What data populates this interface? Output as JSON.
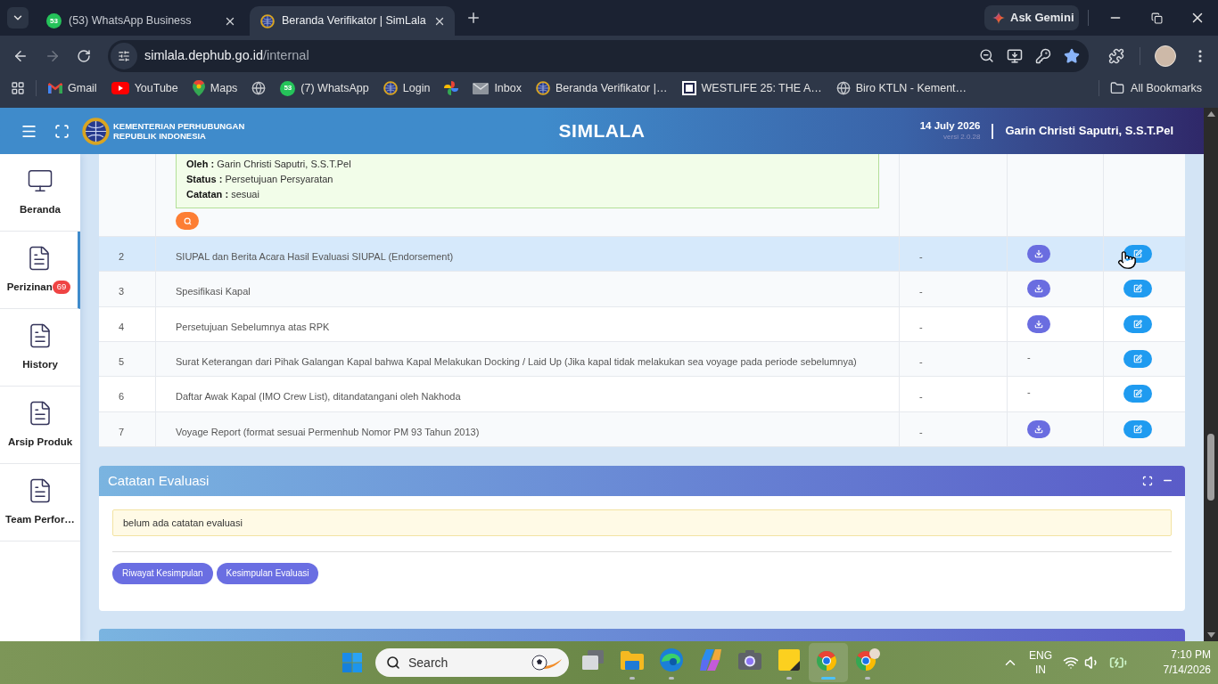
{
  "browser": {
    "tabs": [
      {
        "kind": "whatsapp",
        "favicon_text": "53",
        "title": "(53) WhatsApp Business",
        "selected": false
      },
      {
        "kind": "emblem",
        "title": "Beranda Verifikator | SimLala",
        "selected": true
      }
    ],
    "ask_gemini": "Ask Gemini",
    "url_host": "simlala.dephub.go.id",
    "url_path": "/internal",
    "bookmarks": [
      {
        "kind": "gmail",
        "label": "Gmail"
      },
      {
        "kind": "youtube",
        "label": "YouTube"
      },
      {
        "kind": "maps",
        "label": "Maps"
      },
      {
        "kind": "globe"
      },
      {
        "kind": "whatsapp",
        "icon_text": "53",
        "label": "(7) WhatsApp"
      },
      {
        "kind": "emblem",
        "label": "Login"
      },
      {
        "kind": "photos"
      },
      {
        "kind": "mail",
        "label": "Inbox"
      },
      {
        "kind": "emblem",
        "label": "Beranda Verifikator |…"
      },
      {
        "kind": "logo",
        "label": "WESTLIFE 25: THE A…"
      },
      {
        "kind": "globe",
        "label": "Biro KTLN - Kement…"
      }
    ],
    "all_bookmarks": "All Bookmarks"
  },
  "header": {
    "org_lines": [
      "KEMENTERIAN PERHUBUNGAN",
      "REPUBLIK INDONESIA"
    ],
    "title": "SIMLALA",
    "date": "14 July 2026",
    "version": "versi 2.0.28",
    "user": "Garin Christi Saputri, S.S.T.Pel"
  },
  "sidebar": {
    "items": [
      {
        "kind": "monitor",
        "label": "Beranda",
        "selected": false
      },
      {
        "kind": "document",
        "label": "Perizinan",
        "badge": "69",
        "selected": true
      },
      {
        "kind": "document",
        "label": "History",
        "selected": false
      },
      {
        "kind": "document",
        "label": "Arsip Produk",
        "selected": false
      },
      {
        "kind": "document",
        "label": "Team Perfor…",
        "selected": false
      }
    ]
  },
  "documents": {
    "open_row": {
      "entries": [
        {
          "label": "Oleh :",
          "value": "Garin Christi Saputri, S.S.T.Pel"
        },
        {
          "label": "Status :",
          "value": "Persetujuan Persyaratan"
        },
        {
          "label": "Catatan :",
          "value": "sesuai"
        }
      ]
    },
    "rows": [
      {
        "no": "2",
        "name": "SIUPAL dan Berita Acara Hasil Evaluasi SIUPAL (Endorsement)",
        "column_3": "-",
        "column_4": {
          "kind": "download"
        },
        "column_5": {
          "kind": "edit"
        },
        "hovered": true
      },
      {
        "no": "3",
        "name": "Spesifikasi Kapal",
        "column_3": "-",
        "column_4": {
          "kind": "download"
        },
        "column_5": {
          "kind": "edit"
        },
        "hovered": false
      },
      {
        "no": "4",
        "name": "Persetujuan Sebelumnya atas RPK",
        "column_3": "-",
        "column_4": {
          "kind": "download"
        },
        "column_5": {
          "kind": "edit"
        },
        "hovered": false
      },
      {
        "no": "5",
        "name": "Surat Keterangan dari Pihak Galangan Kapal bahwa Kapal Melakukan Docking / Laid Up (Jika kapal tidak melakukan sea voyage pada periode sebelumnya)",
        "column_3": "-",
        "column_4": {
          "kind": "text",
          "text": "-"
        },
        "column_5": {
          "kind": "edit"
        },
        "hovered": false
      },
      {
        "no": "6",
        "name": "Daftar Awak Kapal (IMO Crew List), ditandatangani oleh Nakhoda",
        "column_3": "-",
        "column_4": {
          "kind": "text",
          "text": "-"
        },
        "column_5": {
          "kind": "edit"
        },
        "hovered": false
      },
      {
        "no": "7",
        "name": "Voyage Report (format sesuai Permenhub Nomor PM 93 Tahun 2013)",
        "column_3": "-",
        "column_4": {
          "kind": "download"
        },
        "column_5": {
          "kind": "edit"
        },
        "hovered": false
      }
    ]
  },
  "evaluation_notes": {
    "title": "Catatan Evaluasi",
    "note": "belum ada catatan evaluasi",
    "buttons": [
      "Riwayat Kesimpulan",
      "Kesimpulan Evaluasi"
    ]
  },
  "taskbar": {
    "placeholder": "Search",
    "apps": [
      {
        "kind": "taskview",
        "running": false,
        "selected": false
      },
      {
        "kind": "explorer",
        "running": true,
        "selected": false
      },
      {
        "kind": "edge",
        "running": true,
        "selected": false
      },
      {
        "kind": "copilot",
        "running": false,
        "selected": false
      },
      {
        "kind": "camera",
        "running": false,
        "selected": false
      },
      {
        "kind": "notes",
        "running": true,
        "selected": false
      },
      {
        "kind": "chrome",
        "running": true,
        "selected": true
      },
      {
        "kind": "chrome-profile",
        "running": true,
        "selected": false
      }
    ],
    "tray": {
      "language": "ENG",
      "region": "IN",
      "time": "7:10 PM",
      "date": "7/14/2026"
    }
  }
}
